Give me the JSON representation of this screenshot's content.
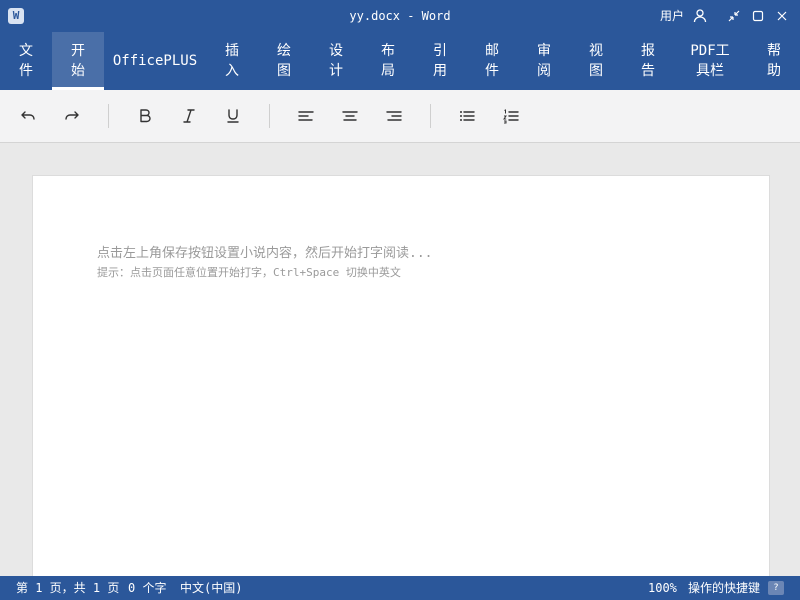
{
  "titlebar": {
    "app_icon_letter": "W",
    "title": "yy.docx - Word",
    "user_label": "用户",
    "icons": [
      "user-icon",
      "restore-down-icon",
      "maximize-icon",
      "close-icon"
    ]
  },
  "ribbon": {
    "tabs": [
      {
        "label": "文\n件"
      },
      {
        "label": "开\n始",
        "active": true
      },
      {
        "label": "OfficePLUS"
      },
      {
        "label": "插\n入"
      },
      {
        "label": "绘\n图"
      },
      {
        "label": "设\n计"
      },
      {
        "label": "布\n局"
      },
      {
        "label": "引\n用"
      },
      {
        "label": "邮\n件"
      },
      {
        "label": "审\n阅"
      },
      {
        "label": "视\n图"
      },
      {
        "label": "报\n告"
      },
      {
        "label": "PDF工\n具栏"
      },
      {
        "label": "帮\n助"
      }
    ]
  },
  "toolbar": {
    "tools": [
      "undo-icon",
      "redo-icon",
      "bold-icon",
      "italic-icon",
      "underline-icon",
      "align-left-icon",
      "align-center-icon",
      "align-right-icon",
      "bullet-list-icon",
      "numbered-list-icon"
    ]
  },
  "document": {
    "hint_main": "点击左上角保存按钮设置小说内容，然后开始打字阅读...",
    "hint_sub": "提示：点击页面任意位置开始打字，Ctrl+Space 切换中英文"
  },
  "statusbar": {
    "page_info": "第 1 页，共 1 页",
    "word_count": "0 个字",
    "language": "中文(中国)",
    "zoom": "100%",
    "shortcuts_label": "操作的快捷键",
    "help_badge": "?"
  },
  "colors": {
    "brand": "#2b579a",
    "active_tab": "#4a6fa8",
    "toolbar_bg": "#f3f3f4",
    "canvas_bg": "#e9e9e9",
    "hint_text": "#9a9a9a"
  }
}
